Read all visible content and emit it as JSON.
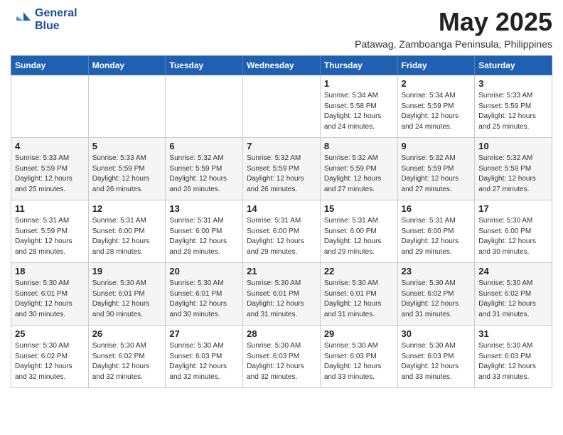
{
  "logo": {
    "line1": "General",
    "line2": "Blue"
  },
  "title": "May 2025",
  "subtitle": "Patawag, Zamboanga Peninsula, Philippines",
  "days_of_week": [
    "Sunday",
    "Monday",
    "Tuesday",
    "Wednesday",
    "Thursday",
    "Friday",
    "Saturday"
  ],
  "weeks": [
    [
      {
        "day": "",
        "info": ""
      },
      {
        "day": "",
        "info": ""
      },
      {
        "day": "",
        "info": ""
      },
      {
        "day": "",
        "info": ""
      },
      {
        "day": "1",
        "info": "Sunrise: 5:34 AM\nSunset: 5:58 PM\nDaylight: 12 hours\nand 24 minutes."
      },
      {
        "day": "2",
        "info": "Sunrise: 5:34 AM\nSunset: 5:59 PM\nDaylight: 12 hours\nand 24 minutes."
      },
      {
        "day": "3",
        "info": "Sunrise: 5:33 AM\nSunset: 5:59 PM\nDaylight: 12 hours\nand 25 minutes."
      }
    ],
    [
      {
        "day": "4",
        "info": "Sunrise: 5:33 AM\nSunset: 5:59 PM\nDaylight: 12 hours\nand 25 minutes."
      },
      {
        "day": "5",
        "info": "Sunrise: 5:33 AM\nSunset: 5:59 PM\nDaylight: 12 hours\nand 26 minutes."
      },
      {
        "day": "6",
        "info": "Sunrise: 5:32 AM\nSunset: 5:59 PM\nDaylight: 12 hours\nand 26 minutes."
      },
      {
        "day": "7",
        "info": "Sunrise: 5:32 AM\nSunset: 5:59 PM\nDaylight: 12 hours\nand 26 minutes."
      },
      {
        "day": "8",
        "info": "Sunrise: 5:32 AM\nSunset: 5:59 PM\nDaylight: 12 hours\nand 27 minutes."
      },
      {
        "day": "9",
        "info": "Sunrise: 5:32 AM\nSunset: 5:59 PM\nDaylight: 12 hours\nand 27 minutes."
      },
      {
        "day": "10",
        "info": "Sunrise: 5:32 AM\nSunset: 5:59 PM\nDaylight: 12 hours\nand 27 minutes."
      }
    ],
    [
      {
        "day": "11",
        "info": "Sunrise: 5:31 AM\nSunset: 5:59 PM\nDaylight: 12 hours\nand 28 minutes."
      },
      {
        "day": "12",
        "info": "Sunrise: 5:31 AM\nSunset: 6:00 PM\nDaylight: 12 hours\nand 28 minutes."
      },
      {
        "day": "13",
        "info": "Sunrise: 5:31 AM\nSunset: 6:00 PM\nDaylight: 12 hours\nand 28 minutes."
      },
      {
        "day": "14",
        "info": "Sunrise: 5:31 AM\nSunset: 6:00 PM\nDaylight: 12 hours\nand 29 minutes."
      },
      {
        "day": "15",
        "info": "Sunrise: 5:31 AM\nSunset: 6:00 PM\nDaylight: 12 hours\nand 29 minutes."
      },
      {
        "day": "16",
        "info": "Sunrise: 5:31 AM\nSunset: 6:00 PM\nDaylight: 12 hours\nand 29 minutes."
      },
      {
        "day": "17",
        "info": "Sunrise: 5:30 AM\nSunset: 6:00 PM\nDaylight: 12 hours\nand 30 minutes."
      }
    ],
    [
      {
        "day": "18",
        "info": "Sunrise: 5:30 AM\nSunset: 6:01 PM\nDaylight: 12 hours\nand 30 minutes."
      },
      {
        "day": "19",
        "info": "Sunrise: 5:30 AM\nSunset: 6:01 PM\nDaylight: 12 hours\nand 30 minutes."
      },
      {
        "day": "20",
        "info": "Sunrise: 5:30 AM\nSunset: 6:01 PM\nDaylight: 12 hours\nand 30 minutes."
      },
      {
        "day": "21",
        "info": "Sunrise: 5:30 AM\nSunset: 6:01 PM\nDaylight: 12 hours\nand 31 minutes."
      },
      {
        "day": "22",
        "info": "Sunrise: 5:30 AM\nSunset: 6:01 PM\nDaylight: 12 hours\nand 31 minutes."
      },
      {
        "day": "23",
        "info": "Sunrise: 5:30 AM\nSunset: 6:02 PM\nDaylight: 12 hours\nand 31 minutes."
      },
      {
        "day": "24",
        "info": "Sunrise: 5:30 AM\nSunset: 6:02 PM\nDaylight: 12 hours\nand 31 minutes."
      }
    ],
    [
      {
        "day": "25",
        "info": "Sunrise: 5:30 AM\nSunset: 6:02 PM\nDaylight: 12 hours\nand 32 minutes."
      },
      {
        "day": "26",
        "info": "Sunrise: 5:30 AM\nSunset: 6:02 PM\nDaylight: 12 hours\nand 32 minutes."
      },
      {
        "day": "27",
        "info": "Sunrise: 5:30 AM\nSunset: 6:03 PM\nDaylight: 12 hours\nand 32 minutes."
      },
      {
        "day": "28",
        "info": "Sunrise: 5:30 AM\nSunset: 6:03 PM\nDaylight: 12 hours\nand 32 minutes."
      },
      {
        "day": "29",
        "info": "Sunrise: 5:30 AM\nSunset: 6:03 PM\nDaylight: 12 hours\nand 33 minutes."
      },
      {
        "day": "30",
        "info": "Sunrise: 5:30 AM\nSunset: 6:03 PM\nDaylight: 12 hours\nand 33 minutes."
      },
      {
        "day": "31",
        "info": "Sunrise: 5:30 AM\nSunset: 6:03 PM\nDaylight: 12 hours\nand 33 minutes."
      }
    ]
  ]
}
